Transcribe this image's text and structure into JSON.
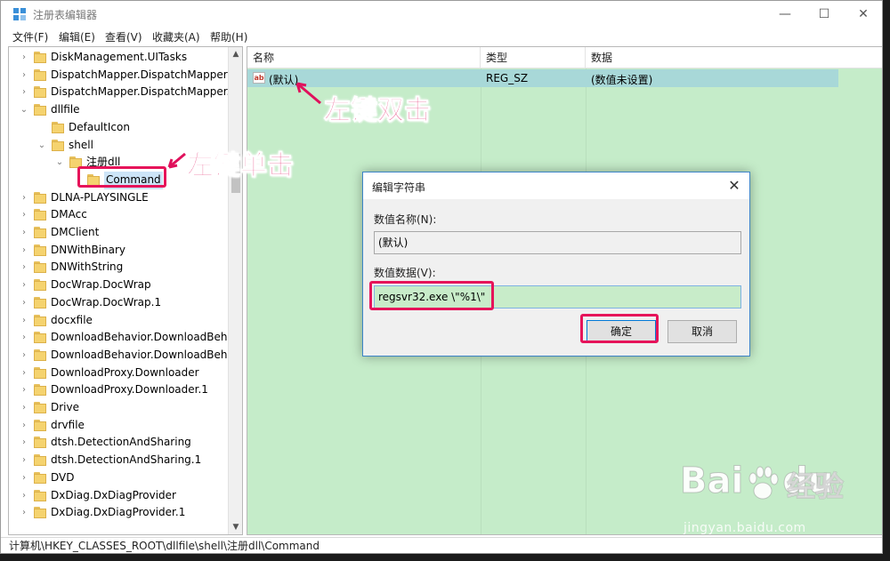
{
  "window": {
    "title": "注册表编辑器",
    "controls": {
      "minimize": "—",
      "maximize": "☐",
      "close": "✕"
    }
  },
  "menu": [
    "文件(F)",
    "编辑(E)",
    "查看(V)",
    "收藏夹(A)",
    "帮助(H)"
  ],
  "tree": {
    "items": [
      {
        "label": "DiskManagement.UITasks",
        "level": 0,
        "expander": "›"
      },
      {
        "label": "DispatchMapper.DispatchMapper",
        "level": 0,
        "expander": "›"
      },
      {
        "label": "DispatchMapper.DispatchMapper.",
        "level": 0,
        "expander": "›"
      },
      {
        "label": "dllfile",
        "level": 0,
        "expander": "⌄"
      },
      {
        "label": "DefaultIcon",
        "level": 1,
        "expander": ""
      },
      {
        "label": "shell",
        "level": 1,
        "expander": "⌄"
      },
      {
        "label": "注册dll",
        "level": 2,
        "expander": "⌄"
      },
      {
        "label": "Command",
        "level": 3,
        "expander": "",
        "selected": true
      },
      {
        "label": "DLNA-PLAYSINGLE",
        "level": 0,
        "expander": "›"
      },
      {
        "label": "DMAcc",
        "level": 0,
        "expander": "›"
      },
      {
        "label": "DMClient",
        "level": 0,
        "expander": "›"
      },
      {
        "label": "DNWithBinary",
        "level": 0,
        "expander": "›"
      },
      {
        "label": "DNWithString",
        "level": 0,
        "expander": "›"
      },
      {
        "label": "DocWrap.DocWrap",
        "level": 0,
        "expander": "›"
      },
      {
        "label": "DocWrap.DocWrap.1",
        "level": 0,
        "expander": "›"
      },
      {
        "label": "docxfile",
        "level": 0,
        "expander": "›"
      },
      {
        "label": "DownloadBehavior.DownloadBeha",
        "level": 0,
        "expander": "›"
      },
      {
        "label": "DownloadBehavior.DownloadBeha",
        "level": 0,
        "expander": "›"
      },
      {
        "label": "DownloadProxy.Downloader",
        "level": 0,
        "expander": "›"
      },
      {
        "label": "DownloadProxy.Downloader.1",
        "level": 0,
        "expander": "›"
      },
      {
        "label": "Drive",
        "level": 0,
        "expander": "›"
      },
      {
        "label": "drvfile",
        "level": 0,
        "expander": "›"
      },
      {
        "label": "dtsh.DetectionAndSharing",
        "level": 0,
        "expander": "›"
      },
      {
        "label": "dtsh.DetectionAndSharing.1",
        "level": 0,
        "expander": "›"
      },
      {
        "label": "DVD",
        "level": 0,
        "expander": "›"
      },
      {
        "label": "DxDiag.DxDiagProvider",
        "level": 0,
        "expander": "›"
      },
      {
        "label": "DxDiag.DxDiagProvider.1",
        "level": 0,
        "expander": "›"
      }
    ],
    "scroll_up": "▲",
    "scroll_down": "▼"
  },
  "list": {
    "columns": [
      "名称",
      "类型",
      "数据"
    ],
    "rows": [
      {
        "icon": "ab",
        "name": "(默认)",
        "type": "REG_SZ",
        "data": "(数值未设置)"
      }
    ]
  },
  "status": "计算机\\HKEY_CLASSES_ROOT\\dllfile\\shell\\注册dll\\Command",
  "dialog": {
    "title": "编辑字符串",
    "close": "✕",
    "name_label": "数值名称(N):",
    "name_value": "(默认)",
    "data_label": "数值数据(V):",
    "data_value": "regsvr32.exe \\\"%1\\\"",
    "ok": "确定",
    "cancel": "取消"
  },
  "annotations": {
    "double_click": "左键双击",
    "single_click": "左键单击"
  },
  "watermark": {
    "brand": "Bai",
    "brand_suffix": "du",
    "product": "经验",
    "url": "jingyan.baidu.com"
  },
  "colors": {
    "annotation": "#e0115c",
    "list_background": "#c5ecc9",
    "selected_row": "#a8d8d8"
  }
}
